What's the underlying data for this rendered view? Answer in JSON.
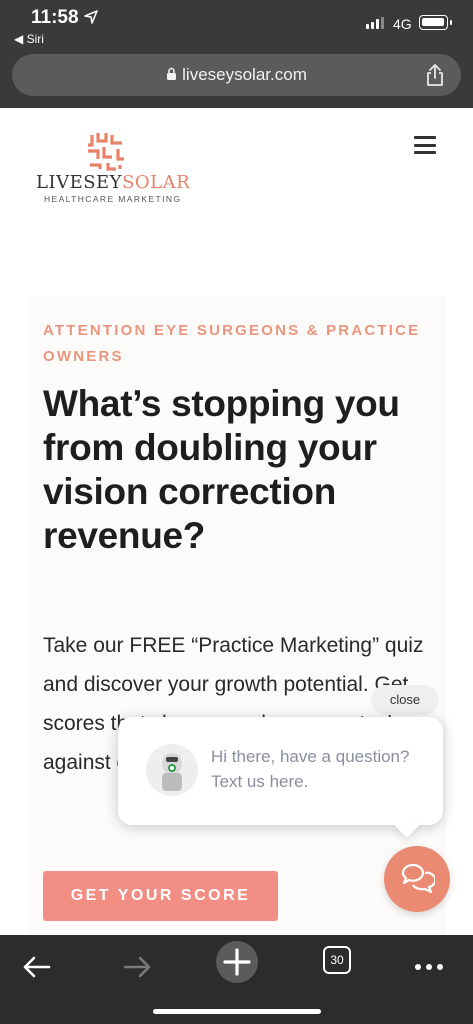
{
  "status": {
    "time": "11:58",
    "back_app": "◀ Siri",
    "network": "4G"
  },
  "browser": {
    "url": "liveseysolar.com",
    "tabs_count": "30"
  },
  "site": {
    "logo_name_1": "LIVESEY",
    "logo_name_2": "SOLAR",
    "logo_tagline": "HEALTHCARE MARKETING",
    "accent": "#e8836a"
  },
  "hero": {
    "eyebrow": "ATTENTION EYE SURGEONS & PRACTICE OWNERS",
    "headline": "What’s stopping you from doubling your vision correction revenue?",
    "body": "Take our FREE “Practice Marketing” quiz and discover your growth potential. Get scores that show you where you stack up against other vision correction practices.",
    "cta_label": "GET YOUR SCORE",
    "cta_color": "#f28e84"
  },
  "chat": {
    "close_label": "close",
    "message": "Hi there, have a question? Text us here.",
    "fab_color": "#ea8a73"
  },
  "icons": {
    "location": "location-arrow-icon",
    "lock": "lock-icon",
    "share": "share-icon",
    "menu": "hamburger-menu-icon",
    "chat": "chat-bubbles-icon",
    "back": "back-arrow-icon",
    "forward": "forward-arrow-icon",
    "new_tab": "plus-icon",
    "more": "more-dots-icon"
  }
}
